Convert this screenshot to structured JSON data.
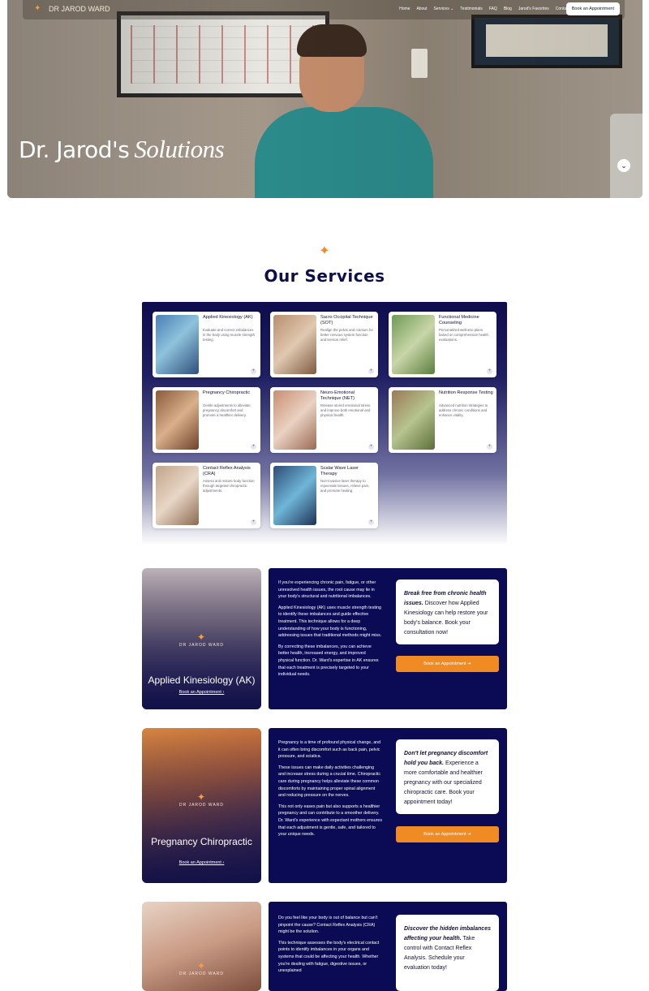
{
  "nav": {
    "logo_text": "DR JAROD WARD",
    "items": [
      "Home",
      "About",
      "Services ⌄",
      "Testimonials",
      "FAQ",
      "Blog",
      "Jarod's Favorites",
      "Contact"
    ],
    "cta": "Book an Appointment"
  },
  "hero": {
    "title": "Dr. Jarod's",
    "title_accent": "Solutions",
    "scroll_icon": "⌄"
  },
  "services": {
    "title": "Our Services",
    "cards": [
      {
        "title": "Applied Kinesiology (AK)",
        "desc": "Evaluate and correct imbalances in the body using muscle strength testing."
      },
      {
        "title": "Sacro Occipital Technique (SOT)",
        "desc": "Realign the pelvis and cranium for better nervous system function and tension relief."
      },
      {
        "title": "Functional Medicine Counseling",
        "desc": "Personalized wellness plans based on comprehensive health evaluations."
      },
      {
        "title": "Pregnancy Chiropractic",
        "desc": "Gentle adjustments to alleviate pregnancy discomfort and promote a healthier delivery."
      },
      {
        "title": "Neuro-Emotional Technique (NET)",
        "desc": "Release stored emotional stress and improve both emotional and physical health."
      },
      {
        "title": "Nutrition Response Testing",
        "desc": "Advanced nutrition strategies to address chronic conditions and enhance vitality."
      },
      {
        "title": "Contact Reflex Analysis (CRA)",
        "desc": "Assess and restore body function through targeted chiropractic adjustments."
      },
      {
        "title": "Scalar Wave Laser Therapy",
        "desc": "Non-invasive laser therapy to rejuvenate tissues, relieve pain, and promote healing."
      }
    ]
  },
  "sections": [
    {
      "brand": "DR JAROD WARD",
      "name": "Applied Kinesiology (AK)",
      "link": "Book an Appointment ›",
      "paragraphs": [
        "If you're experiencing chronic pain, fatigue, or other unresolved health issues, the root cause may lie in your body's structural and nutritional imbalances.",
        "Applied Kinesiology (AK) uses muscle strength testing to identify these imbalances and guide effective treatment. This technique allows for a deep understanding of how your body is functioning, addressing issues that traditional methods might miss.",
        "By correcting these imbalances, you can achieve better health, increased energy, and improved physical function. Dr. Ward's expertise in AK ensures that each treatment is precisely targeted to your individual needs."
      ],
      "callout_bold": "Break free from chronic health issues.",
      "callout_rest": " Discover how Applied Kinesiology can help restore your body's balance. Book your consultation now!",
      "button": "Book an Appointment ➜"
    },
    {
      "brand": "DR JAROD WARD",
      "name": "Pregnancy Chiropractic",
      "link": "Book an Appointment ›",
      "paragraphs": [
        "Pregnancy is a time of profound physical change, and it can often bring discomfort such as back pain, pelvic pressure, and sciatica.",
        "These issues can make daily activities challenging and increase stress during a crucial time. Chiropractic care during pregnancy helps alleviate these common discomforts by maintaining proper spinal alignment and reducing pressure on the nerves.",
        "This not only eases pain but also supports a healthier pregnancy and can contribute to a smoother delivery. Dr. Ward's experience with expectant mothers ensures that each adjustment is gentle, safe, and tailored to your unique needs."
      ],
      "callout_bold": "Don't let pregnancy discomfort hold you back.",
      "callout_rest": " Experience a more comfortable and healthier pregnancy with our specialized chiropractic care. Book your appointment today!",
      "button": "Book an Appointment ➜"
    },
    {
      "brand": "DR JAROD WARD",
      "paragraphs": [
        "Do you feel like your body is out of balance but can't pinpoint the cause? Contact Reflex Analysis (CRA) might be the solution.",
        "This technique assesses the body's electrical contact points to identify imbalances in your organs and systems that could be affecting your health. Whether you're dealing with fatigue, digestive issues, or unexplained"
      ],
      "callout_bold": "Discover the hidden imbalances affecting your health.",
      "callout_rest": " Take control with Contact Reflex Analysis. Schedule your evaluation today!"
    }
  ],
  "colors": {
    "navy": "#0b0b55",
    "orange": "#f08a22",
    "heading": "#0f0f47"
  }
}
